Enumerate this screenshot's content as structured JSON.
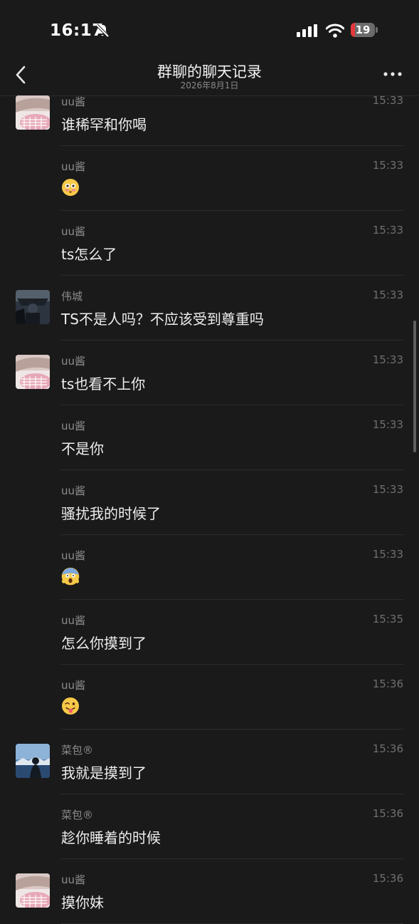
{
  "status": {
    "time": "16:17",
    "battery": "19",
    "battery_level": 0.19,
    "accent_battery": "#e5383b"
  },
  "header": {
    "title": "群聊的聊天记录",
    "subtitle": "2026年8月1日"
  },
  "messages": [
    {
      "name": "uu酱",
      "time": "15:33",
      "text": "谁稀罕和你喝",
      "avatar": "uu"
    },
    {
      "name": "uu酱",
      "time": "15:33",
      "emoji": "flushed-face",
      "avatar": ""
    },
    {
      "name": "uu酱",
      "time": "15:33",
      "text": "ts怎么了",
      "avatar": ""
    },
    {
      "name": "伟城",
      "time": "15:33",
      "text": "TS不是人吗？不应该受到尊重吗",
      "avatar": "weicheng"
    },
    {
      "name": "uu酱",
      "time": "15:33",
      "text": "ts也看不上你",
      "avatar": "uu"
    },
    {
      "name": "uu酱",
      "time": "15:33",
      "text": "不是你",
      "avatar": ""
    },
    {
      "name": "uu酱",
      "time": "15:33",
      "text": "骚扰我的时候了",
      "avatar": ""
    },
    {
      "name": "uu酱",
      "time": "15:33",
      "emoji": "screaming-face",
      "avatar": ""
    },
    {
      "name": "uu酱",
      "time": "15:35",
      "text": "怎么你摸到了",
      "avatar": ""
    },
    {
      "name": "uu酱",
      "time": "15:36",
      "emoji": "winking-tongue-face",
      "avatar": ""
    },
    {
      "name": "菜包®",
      "time": "15:36",
      "text": "我就是摸到了",
      "avatar": "caibao"
    },
    {
      "name": "菜包®",
      "time": "15:36",
      "text": "趁你睡着的时候",
      "avatar": ""
    },
    {
      "name": "uu酱",
      "time": "15:36",
      "text": "摸你妹",
      "avatar": "uu"
    }
  ]
}
